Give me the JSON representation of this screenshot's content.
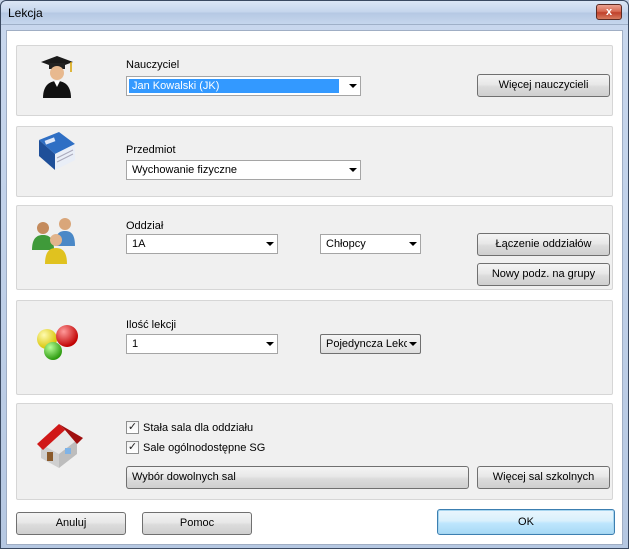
{
  "window": {
    "title": "Lekcja",
    "close_glyph": "x"
  },
  "teacher": {
    "label": "Nauczyciel",
    "selected": "Jan Kowalski (JK)",
    "more_button": "Więcej nauczycieli"
  },
  "subject": {
    "label": "Przedmiot",
    "selected": "Wychowanie fizyczne"
  },
  "class_group": {
    "label": "Oddział",
    "selected": "1A",
    "group_selected": "Chłopcy",
    "merge_button": "Łączenie oddziałów",
    "new_split_button": "Nowy podz. na grupy"
  },
  "lessons": {
    "label": "Ilość lekcji",
    "selected": "1",
    "type_selected": "Pojedyncza Lekc"
  },
  "rooms": {
    "fixed_room_label": "Stała sala dla oddziału",
    "fixed_room_checked": true,
    "common_rooms_label": "Sale ogólnodostępne SG",
    "common_rooms_checked": true,
    "check_glyph": "✓",
    "pick_rooms_button": "Wybór dowolnych sal",
    "more_rooms_button": "Więcej sal szkolnych"
  },
  "footer": {
    "cancel_button": "Anuluj",
    "help_button": "Pomoc",
    "ok_button": "OK"
  },
  "icons": {
    "teacher": "graduate-icon",
    "subject": "book-icon",
    "class": "group-icon",
    "lessons": "balls-icon",
    "rooms": "house-icon"
  }
}
